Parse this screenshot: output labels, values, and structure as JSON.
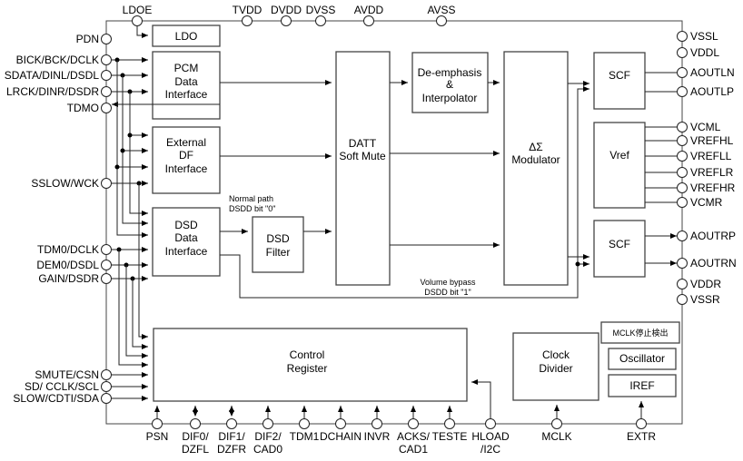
{
  "pins": {
    "top": [
      "LDOE",
      "TVDD",
      "DVDD",
      "DVSS",
      "AVDD",
      "AVSS"
    ],
    "left": [
      "PDN",
      "BICK/BCK/DCLK",
      "SDATA/DINL/DSDL",
      "LRCK/DINR/DSDR",
      "TDMO",
      "SSLOW/WCK",
      "TDM0/DCLK",
      "DEM0/DSDL",
      "GAIN/DSDR",
      "SMUTE/CSN",
      "SD/ CCLK/SCL",
      "SLOW/CDTI/SDA"
    ],
    "right": [
      "VSSL",
      "VDDL",
      "AOUTLN",
      "AOUTLP",
      "VCML",
      "VREFHL",
      "VREFLL",
      "VREFLR",
      "VREFHR",
      "VCMR",
      "AOUTRP",
      "AOUTRN",
      "VDDR",
      "VSSR"
    ],
    "bottom": [
      {
        "line1": "PSN",
        "line2": ""
      },
      {
        "line1": "DIF0/",
        "line2": "DZFL"
      },
      {
        "line1": "DIF1/",
        "line2": "DZFR"
      },
      {
        "line1": "DIF2/",
        "line2": "CAD0"
      },
      {
        "line1": "TDM1",
        "line2": ""
      },
      {
        "line1": "DCHAIN",
        "line2": ""
      },
      {
        "line1": "INVR",
        "line2": ""
      },
      {
        "line1": "ACKS/",
        "line2": "CAD1"
      },
      {
        "line1": "TESTE",
        "line2": ""
      },
      {
        "line1": "HLOAD",
        "line2": "/I2C"
      },
      {
        "line1": "MCLK",
        "line2": ""
      },
      {
        "line1": "EXTR",
        "line2": ""
      }
    ]
  },
  "blocks": {
    "ldo": "LDO",
    "pcm": [
      "PCM",
      "Data",
      "Interface"
    ],
    "extdf": [
      "External",
      "DF",
      "Interface"
    ],
    "dsd": [
      "DSD",
      "Data",
      "Interface"
    ],
    "dsdfilter": [
      "DSD",
      "Filter"
    ],
    "datt": [
      "DATT",
      "Soft Mute"
    ],
    "deemph": [
      "De-emphasis",
      "&",
      "Interpolator"
    ],
    "modulator": [
      "ΔΣ",
      "Modulator"
    ],
    "scf_l": "SCF",
    "vref": "Vref",
    "scf_r": "SCF",
    "control": [
      "Control",
      "Register"
    ],
    "clock": [
      "Clock",
      "Divider"
    ],
    "mclkdet": "MCLK停止検出",
    "osc": "Oscillator",
    "iref": "IREF"
  },
  "annotations": {
    "normal_path": [
      "Normal path",
      "DSDD bit \"0\""
    ],
    "volume_bypass": [
      "Volume bypass",
      "DSDD bit \"1\""
    ]
  }
}
